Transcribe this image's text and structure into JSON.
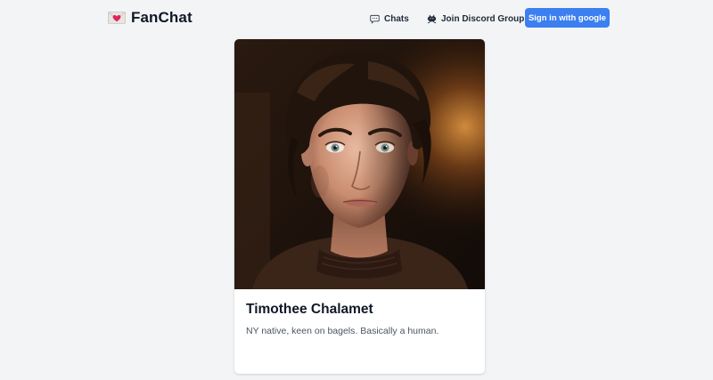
{
  "brand": {
    "name": "FanChat",
    "logo_icon": "love-letter-icon"
  },
  "nav": {
    "chats_label": "Chats",
    "chats_icon": "speech-bubble-icon",
    "discord_label": "Join Discord Group",
    "discord_icon": "alien-monster-icon",
    "signin_label": "Sign in with google"
  },
  "colors": {
    "accent": "#3b7ff0",
    "background": "#f3f4f6"
  },
  "character": {
    "name": "Timothee Chalamet",
    "description": "NY native, keen on bagels. Basically a human.",
    "image_alt": "Portrait of Timothee Chalamet"
  }
}
